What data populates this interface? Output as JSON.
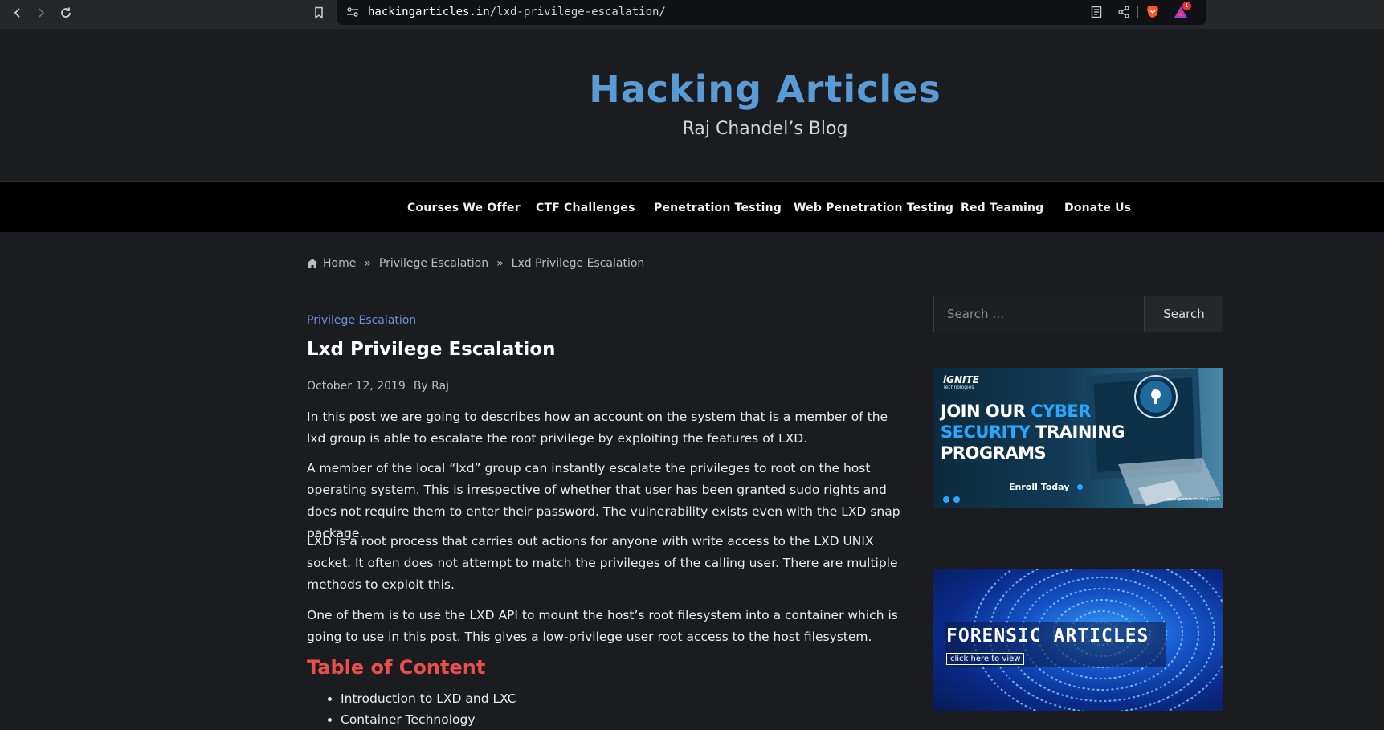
{
  "browser": {
    "url_domain": "hackingarticles.in",
    "url_path": "/lxd-privilege-escalation/",
    "notification_count": "1"
  },
  "header": {
    "site_title": "Hacking Articles",
    "site_description": "Raj Chandel’s Blog"
  },
  "nav": {
    "items": [
      {
        "label": "Courses We Offer"
      },
      {
        "label": "CTF Challenges"
      },
      {
        "label": "Penetration Testing"
      },
      {
        "label": "Web Penetration Testing"
      },
      {
        "label": "Red Teaming"
      },
      {
        "label": "Donate Us"
      }
    ]
  },
  "breadcrumb": {
    "home": "Home",
    "sep": "»",
    "category": "Privilege Escalation",
    "current": "Lxd Privilege Escalation"
  },
  "post": {
    "category": "Privilege Escalation",
    "title": "Lxd Privilege Escalation",
    "date": "October 12, 2019",
    "author": "By Raj",
    "paragraphs": [
      "In this post we are going to describes how an account on the system that is a member of the lxd group is able to escalate the root privilege by exploiting the features of LXD.",
      "A member of the local “lxd” group can instantly escalate the privileges to root on the host operating system. This is irrespective of whether that user has been granted sudo rights and does not require them to enter their password. The vulnerability exists even with the LXD snap package.",
      "LXD is a root process that carries out actions for anyone with write access to the LXD UNIX socket. It often does not attempt to match the privileges of the calling user. There are multiple methods to exploit this.",
      "One of them is to use the LXD API to mount the host’s root filesystem into a container which is going to use in this post. This gives a low-privilege user root access to the host filesystem."
    ],
    "toc_title": "Table of Content",
    "toc_items": [
      "Introduction to LXD and LXC",
      "Container Technology"
    ]
  },
  "sidebar": {
    "search_placeholder": "Search …",
    "search_button": "Search",
    "ad1": {
      "brand": "iGNITE",
      "brand_sub": "Technologies",
      "line1a": "JOIN OUR ",
      "line1b": "CYBER",
      "line2a": "SECURITY",
      "line2b": " TRAINING",
      "line3": "PROGRAMS",
      "cta": "Enroll Today",
      "website": "www.ignitetechnologies.in"
    },
    "ad2": {
      "title": "FORENSIC ARTICLES",
      "cta": "click here to view"
    }
  },
  "colors": {
    "site_title": "#5b9bd5",
    "category_link": "#6e8fdc",
    "toc_title": "#e8504f",
    "background": "#1b1c1f",
    "nav_background": "#000000"
  }
}
